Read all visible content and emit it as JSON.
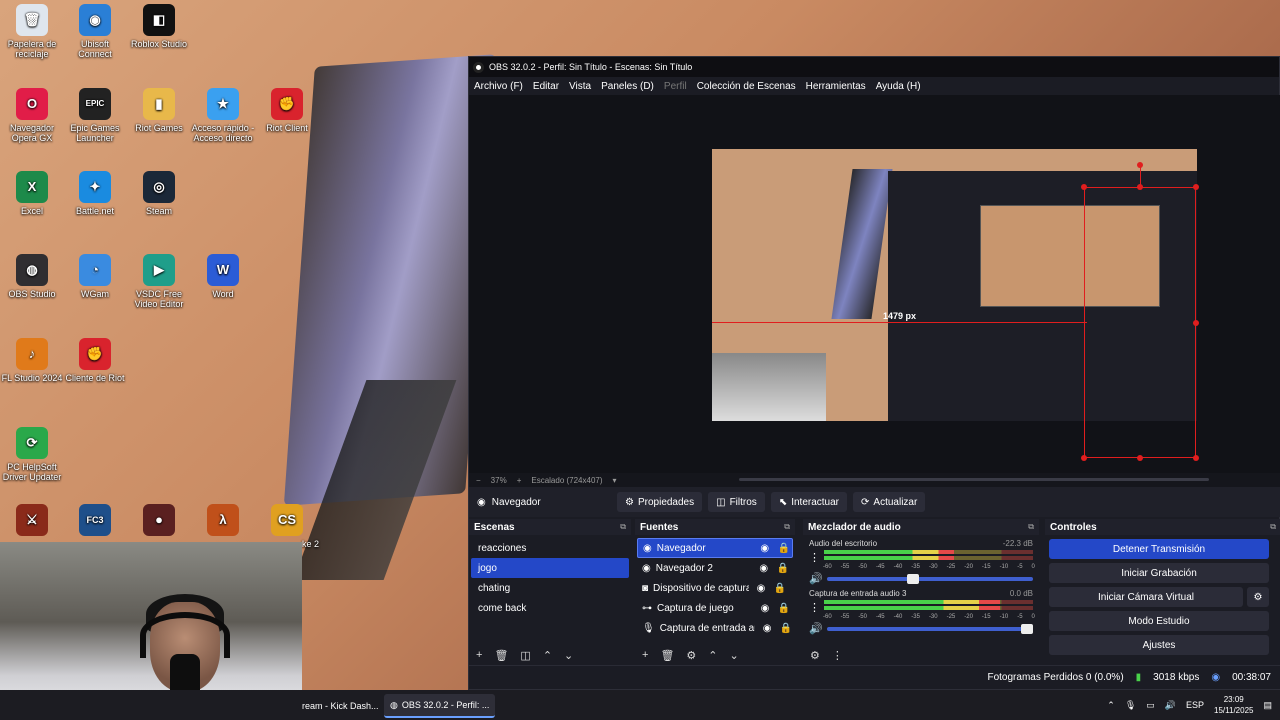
{
  "desktop": {
    "icons": [
      {
        "label": "Papelera de reciclaje",
        "icon": "recycle-bin-icon",
        "glyph": "🗑",
        "color": "#dfe6ee"
      },
      {
        "label": "Ubisoft Connect",
        "icon": "ubisoft-icon",
        "glyph": "◉",
        "color": "#2a7fd6"
      },
      {
        "label": "Roblox Studio",
        "icon": "roblox-icon",
        "glyph": "◧",
        "color": "#111111"
      },
      {
        "label": "Navegador Opera GX",
        "icon": "opera-gx-icon",
        "glyph": "O",
        "color": "#e11d48"
      },
      {
        "label": "Epic Games Launcher",
        "icon": "epic-games-icon",
        "glyph": "EPIC",
        "color": "#222222"
      },
      {
        "label": "Riot Games",
        "icon": "folder-icon",
        "glyph": "▮",
        "color": "#e8b84a"
      },
      {
        "label": "Acceso rápido - Acceso directo",
        "icon": "star-icon",
        "glyph": "★",
        "color": "#3aa0f0"
      },
      {
        "label": "Riot Client",
        "icon": "riot-client-icon",
        "glyph": "✊",
        "color": "#d9232d"
      },
      {
        "label": "Excel",
        "icon": "excel-icon",
        "glyph": "X",
        "color": "#1d8a4a"
      },
      {
        "label": "Battle.net",
        "icon": "battlenet-icon",
        "glyph": "✦",
        "color": "#1a8be0"
      },
      {
        "label": "Steam",
        "icon": "steam-icon",
        "glyph": "◎",
        "color": "#1b2838"
      },
      {
        "label": "OBS Studio",
        "icon": "obs-icon",
        "glyph": "◍",
        "color": "#302e31"
      },
      {
        "label": "WGam",
        "icon": "wgam-icon",
        "glyph": "◔",
        "color": "#3a8be0"
      },
      {
        "label": "VSDC Free Video Editor",
        "icon": "vsdc-icon",
        "glyph": "▶",
        "color": "#1f9e8a"
      },
      {
        "label": "Word",
        "icon": "word-icon",
        "glyph": "W",
        "color": "#2b5cd6"
      },
      {
        "label": "FL Studio 2024",
        "icon": "fl-studio-icon",
        "glyph": "♪",
        "color": "#e07a1a"
      },
      {
        "label": "Cliente de Riot",
        "icon": "riot-client-icon",
        "glyph": "✊",
        "color": "#d9232d"
      },
      {
        "label": "PC HelpSoft Driver Updater",
        "icon": "driver-updater-icon",
        "glyph": "⟳",
        "color": "#2aa84a"
      }
    ],
    "bottom_icons": [
      {
        "label": "",
        "icon": "game-icon",
        "glyph": "⚔",
        "color": "#8a2a1a"
      },
      {
        "label": "",
        "icon": "fc3-icon",
        "glyph": "FC3",
        "color": "#1e4f8a"
      },
      {
        "label": "",
        "icon": "game-icon",
        "glyph": "●",
        "color": "#5a2020"
      },
      {
        "label": "",
        "icon": "half-life-icon",
        "glyph": "λ",
        "color": "#c0501a"
      },
      {
        "label": "ke 2",
        "icon": "counter-strike-icon",
        "glyph": "CS",
        "color": "#e0a020"
      }
    ]
  },
  "obs": {
    "title": "OBS 32.0.2 - Perfil: Sin Título - Escenas: Sin Título",
    "menu": [
      {
        "label": "Archivo (F)",
        "dim": false
      },
      {
        "label": "Editar",
        "dim": false
      },
      {
        "label": "Vista",
        "dim": false
      },
      {
        "label": "Paneles (D)",
        "dim": false
      },
      {
        "label": "Perfil",
        "dim": true
      },
      {
        "label": "Colección de Escenas",
        "dim": false
      },
      {
        "label": "Herramientas",
        "dim": false
      },
      {
        "label": "Ayuda (H)",
        "dim": false
      }
    ],
    "preview": {
      "size_label": "1479 px",
      "zoom": "37%",
      "scale_label": "Escalado (724x407)"
    },
    "source_bar": {
      "selected": "Navegador",
      "buttons": [
        {
          "label": "Propiedades",
          "icon": "gear-icon",
          "glyph": "⚙"
        },
        {
          "label": "Filtros",
          "icon": "filter-icon",
          "glyph": "◫"
        },
        {
          "label": "Interactuar",
          "icon": "cursor-icon",
          "glyph": "⬉"
        },
        {
          "label": "Actualizar",
          "icon": "refresh-icon",
          "glyph": "⟳"
        }
      ]
    },
    "scenes": {
      "title": "Escenas",
      "items": [
        "reacciones",
        "jogo",
        "chating",
        "come back"
      ],
      "selected_index": 1
    },
    "sources": {
      "title": "Fuentes",
      "items": [
        {
          "label": "Navegador",
          "icon": "globe-icon",
          "glyph": "◉"
        },
        {
          "label": "Navegador 2",
          "icon": "globe-icon",
          "glyph": "◉"
        },
        {
          "label": "Dispositivo de captura de video",
          "icon": "camera-icon",
          "glyph": "◙"
        },
        {
          "label": "Captura de juego",
          "icon": "gamepad-icon",
          "glyph": "⊶"
        },
        {
          "label": "Captura de entrada audio",
          "icon": "microphone-icon",
          "glyph": "🎙"
        }
      ],
      "selected_index": 0
    },
    "mixer": {
      "title": "Mezclador de audio",
      "scale": [
        "-60",
        "-55",
        "-50",
        "-45",
        "-40",
        "-35",
        "-30",
        "-25",
        "-20",
        "-15",
        "-10",
        "-5",
        "0"
      ],
      "channels": [
        {
          "name": "Audio del escritorio",
          "db": "-22.3 dB",
          "level": 0.62,
          "volume": 0.42
        },
        {
          "name": "Captura de entrada audio 3",
          "db": "0.0 dB",
          "level": 0.84,
          "volume": 0.97
        }
      ]
    },
    "controls": {
      "title": "Controles",
      "buttons": [
        "Detener Transmisión",
        "Iniciar Grabación",
        "Iniciar Cámara Virtual",
        "Modo Estudio",
        "Ajustes"
      ]
    },
    "status": {
      "dropped": "Fotogramas Perdidos 0 (0.0%)",
      "bitrate": "3018 kbps",
      "time": "00:38:07"
    }
  },
  "taskbar": {
    "items": [
      {
        "label": "ream - Kick Dash...",
        "active": false
      },
      {
        "label": "OBS 32.0.2 - Perfil: ...",
        "active": true
      }
    ],
    "lang": "ESP",
    "time": "23:09",
    "date": "15/11/2025"
  },
  "colors": {
    "accent": "#2448c8",
    "selection": "#e01e1e",
    "meter_green": "#49d24a"
  }
}
